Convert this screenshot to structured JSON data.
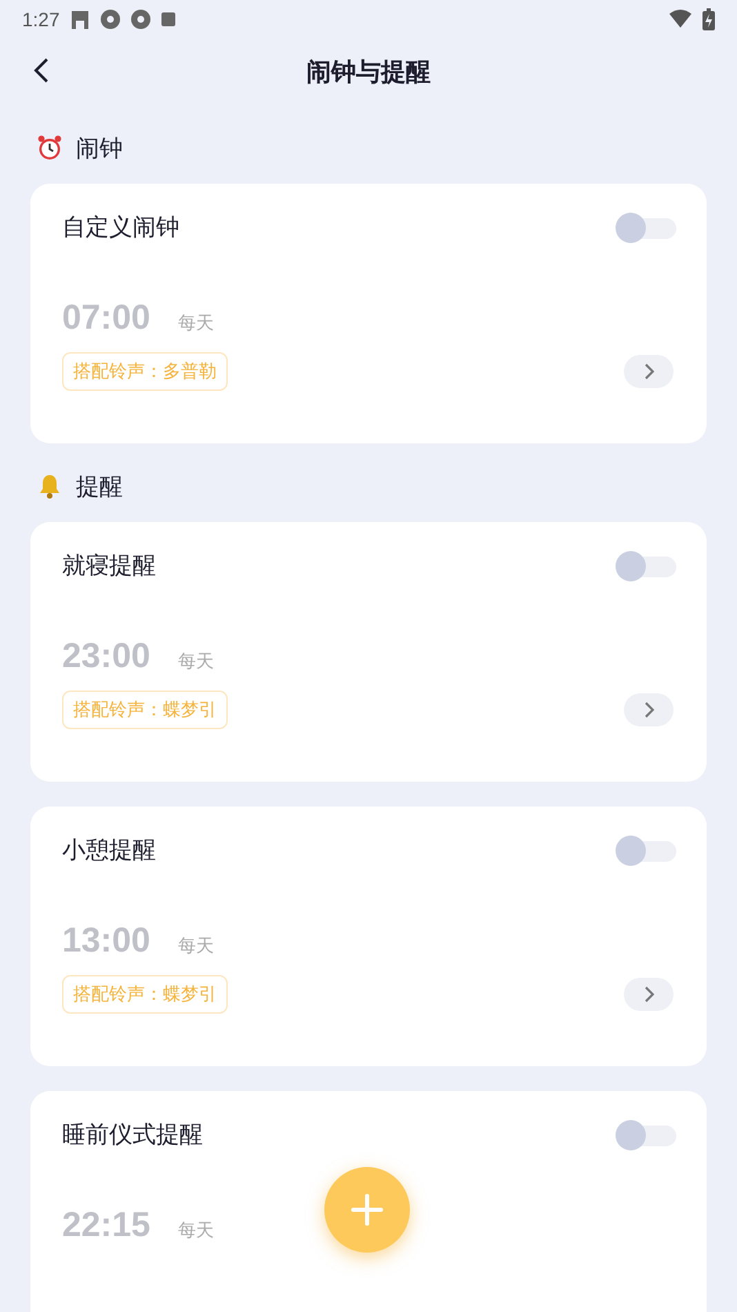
{
  "status_bar": {
    "time": "1:27"
  },
  "header": {
    "title": "闹钟与提醒"
  },
  "sections": [
    {
      "kind": "alarm",
      "title": "闹钟",
      "cards": [
        {
          "title": "自定义闹钟",
          "on": false,
          "time": "07:00",
          "repeat": "每天",
          "ringtone": "搭配铃声：多普勒"
        }
      ]
    },
    {
      "kind": "reminder",
      "title": "提醒",
      "cards": [
        {
          "title": "就寝提醒",
          "on": false,
          "time": "23:00",
          "repeat": "每天",
          "ringtone": "搭配铃声：蝶梦引"
        },
        {
          "title": "小憩提醒",
          "on": false,
          "time": "13:00",
          "repeat": "每天",
          "ringtone": "搭配铃声：蝶梦引"
        },
        {
          "title": "睡前仪式提醒",
          "on": false,
          "time": "22:15",
          "repeat": "每天"
        }
      ]
    }
  ]
}
